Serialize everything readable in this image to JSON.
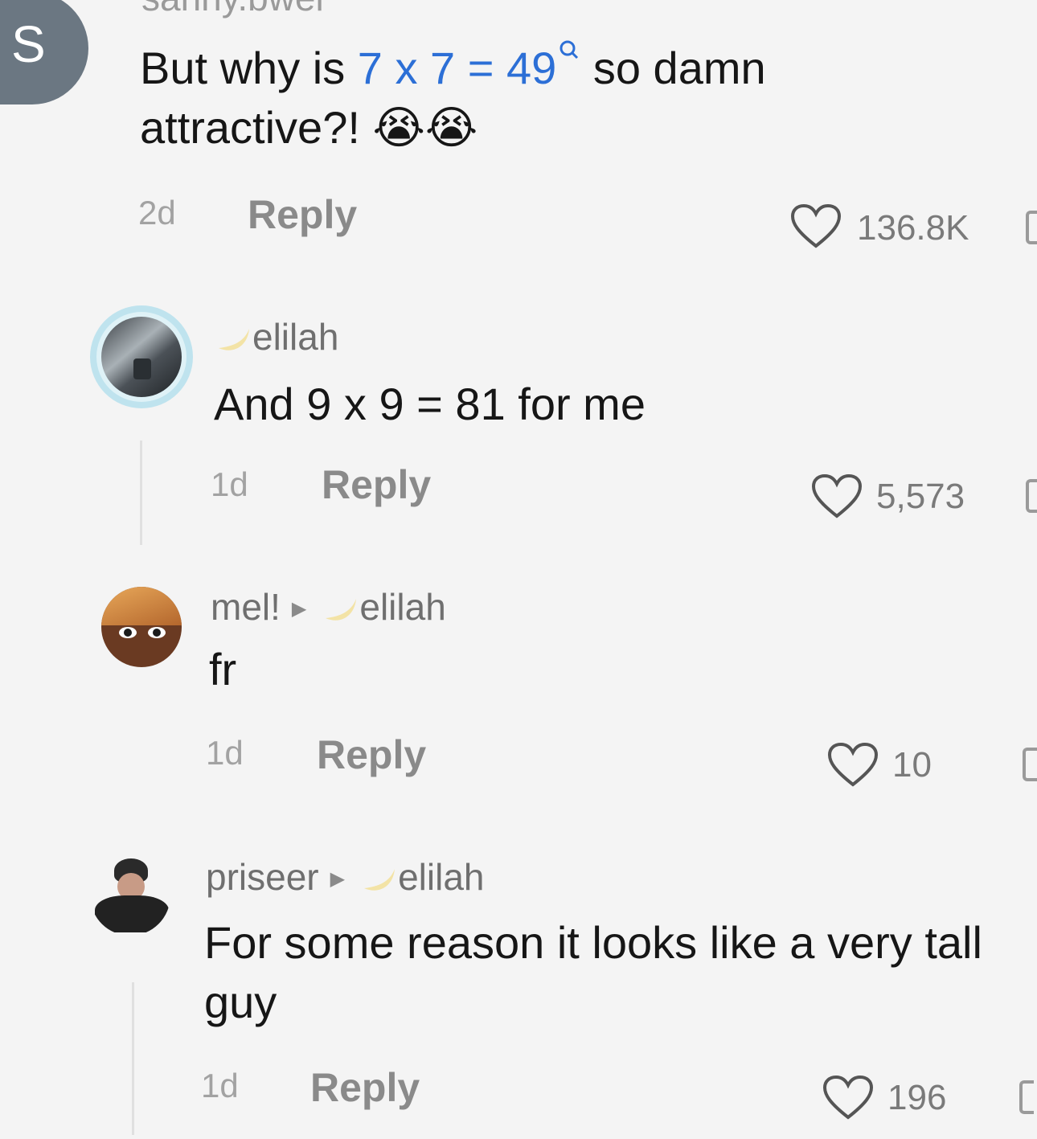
{
  "comments": [
    {
      "avatar_letter": "S",
      "username": "sanny.bwel",
      "text_before": "But why is ",
      "text_highlight": "7 x 7 = 49",
      "text_after": " so damn attractive?! 😭😭",
      "time": "2d",
      "reply_label": "Reply",
      "likes": "136.8K"
    },
    {
      "username": "elilah",
      "text": "And 9 x 9 = 81 for me",
      "time": "1d",
      "reply_label": "Reply",
      "likes": "5,573"
    },
    {
      "username": "mel!",
      "reply_to": "elilah",
      "text": "fr",
      "time": "1d",
      "reply_label": "Reply",
      "likes": "10"
    },
    {
      "username": "priseer",
      "reply_to": "elilah",
      "text": "For some reason it looks like a very tall guy",
      "time": "1d",
      "reply_label": "Reply",
      "likes": "196"
    }
  ],
  "colors": {
    "highlight": "#2c6fd6",
    "avatar_s": "#6b7782"
  },
  "icons": [
    "heart-icon",
    "search-icon",
    "moon-icon",
    "arrow-right-icon",
    "dislike-icon"
  ]
}
